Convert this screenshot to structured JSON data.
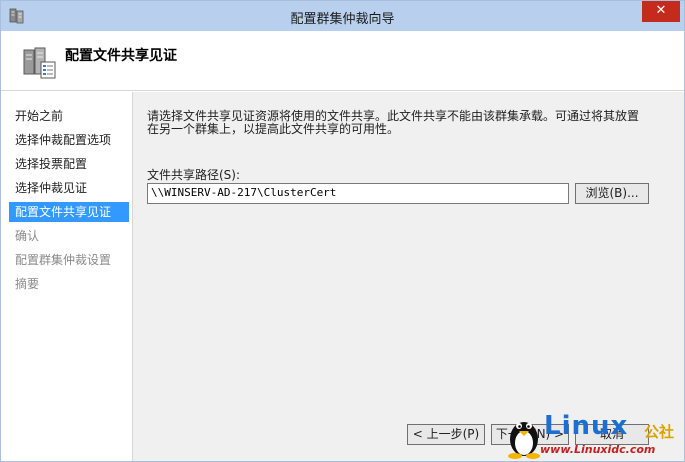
{
  "window": {
    "title": "配置群集仲裁向导",
    "close_label": "✕"
  },
  "header": {
    "title": "配置文件共享见证"
  },
  "nav": {
    "items": [
      {
        "label": "开始之前",
        "state": "normal"
      },
      {
        "label": "选择仲裁配置选项",
        "state": "normal"
      },
      {
        "label": "选择投票配置",
        "state": "normal"
      },
      {
        "label": "选择仲裁见证",
        "state": "normal"
      },
      {
        "label": "配置文件共享见证",
        "state": "active"
      },
      {
        "label": "确认",
        "state": "disabled"
      },
      {
        "label": "配置群集仲裁设置",
        "state": "disabled"
      },
      {
        "label": "摘要",
        "state": "disabled"
      }
    ]
  },
  "main": {
    "description_line1": "请选择文件共享见证资源将使用的文件共享。此文件共享不能由该群集承载。可通过将其放置",
    "description_line2": "在另一个群集上，以提高此文件共享的可用性。",
    "path_label": "文件共享路径(S):",
    "path_value": "\\\\WINSERV-AD-217\\ClusterCert",
    "browse_label": "浏览(B)..."
  },
  "buttons": {
    "prev_label": "< 上一步(P)",
    "next_label": "下一步(N) >",
    "cancel_label": "取消"
  },
  "watermark": {
    "brand": "Linux",
    "cn": "公社",
    "url": "www.Linuxidc.com"
  },
  "colors": {
    "titlebar": "#b8d0ee",
    "nav_active": "#3399ff",
    "close": "#c42b1c"
  },
  "icons": {
    "app": "cluster-app-icon",
    "header": "server-cluster-icon",
    "close": "close-icon",
    "watermark": "tux-penguin-icon"
  }
}
